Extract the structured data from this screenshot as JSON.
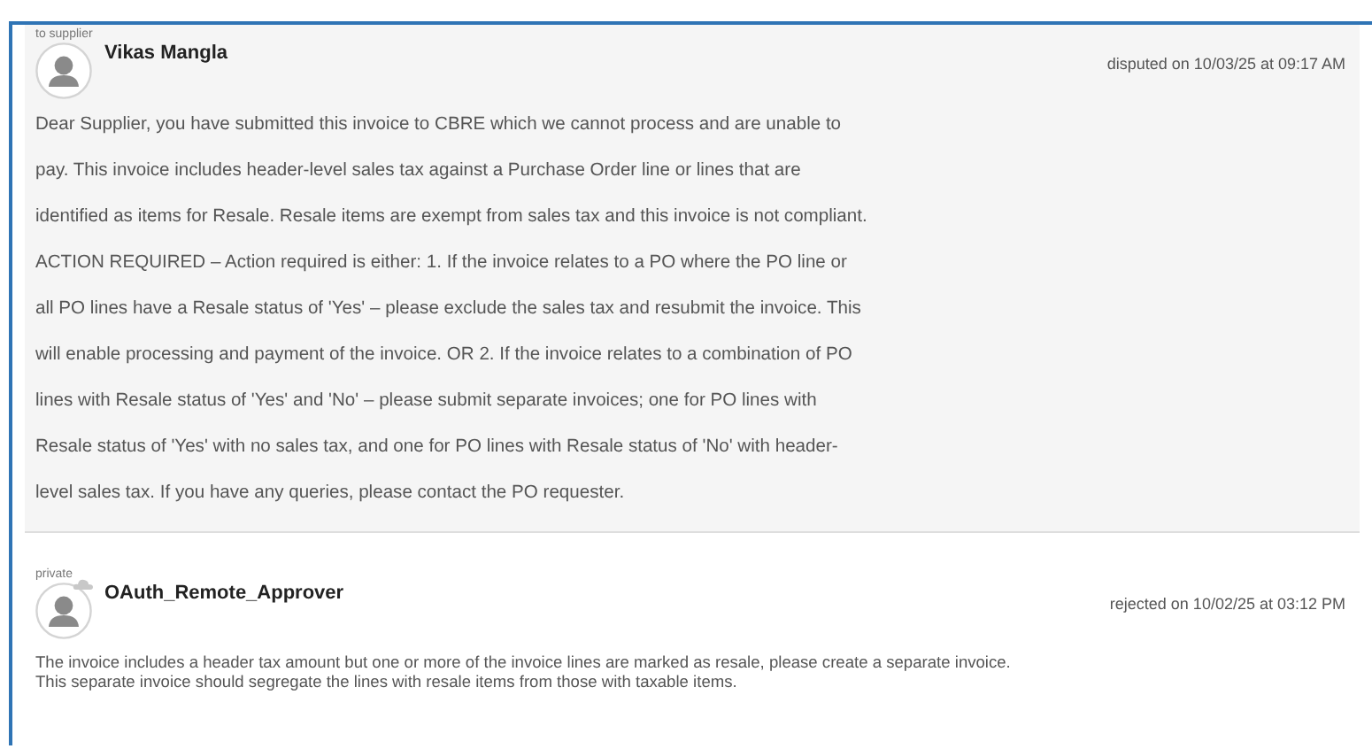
{
  "comments": [
    {
      "audience": "to supplier",
      "author": "Vikas Mangla",
      "timestamp": "disputed on 10/03/25 at 09:17 AM",
      "highlighted": true,
      "has_badge": false,
      "body": "Dear Supplier, you have submitted this invoice to CBRE which we cannot process and are unable to pay. This invoice includes header-level sales tax against a Purchase Order line or lines that are identified as items for Resale. Resale items are exempt from sales tax and this invoice is not compliant. ACTION REQUIRED – Action required is either: 1. If the invoice relates to a PO where the PO line or all PO lines have a Resale status of 'Yes' – please exclude the sales tax and resubmit the invoice. This will enable processing and payment of the invoice. OR 2. If the invoice relates to a combination of PO lines with Resale status of 'Yes' and 'No' – please submit separate invoices; one for PO lines with Resale status of 'Yes' with no sales tax, and one for PO lines with Resale status of 'No' with header-level sales tax. If you have any queries, please contact the PO requester."
    },
    {
      "audience": "private",
      "author": "OAuth_Remote_Approver",
      "timestamp": "rejected on 10/02/25 at 03:12 PM",
      "highlighted": false,
      "has_badge": true,
      "body": "The invoice includes a header tax amount but one or more of the invoice lines are marked as resale, please create a separate invoice.\nThis separate invoice should segregate the lines with resale items from those with taxable items."
    }
  ]
}
